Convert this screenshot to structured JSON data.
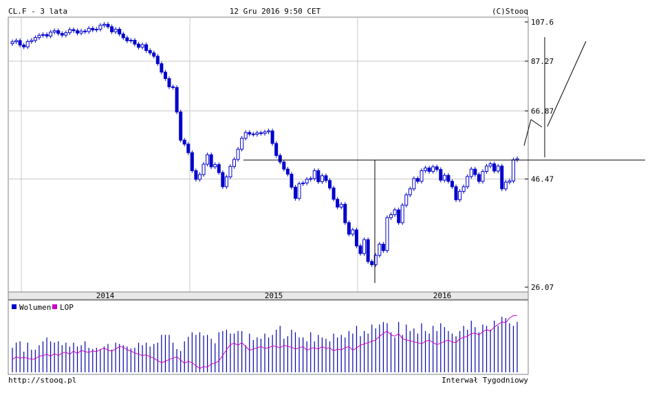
{
  "header": {
    "symbol_period": "CL.F - 3 lata",
    "datetime": "12 Gru 2016 9:50 CET",
    "copyright": "(C)Stooq"
  },
  "footer": {
    "url": "http://stooq.pl",
    "interval": "Interwał Tygodniowy"
  },
  "colors": {
    "bull_candle": "#ffffff",
    "bear_candle": "#0000cc",
    "candle_outline": "#0000cc",
    "volume_bar": "#0000aa",
    "lop_line": "#cc00cc",
    "grid": "#c8c8c8",
    "year_band": "#e8e8e8"
  },
  "chart_data": [
    {
      "type": "candlestick",
      "title": "CL.F - 3 lata",
      "ylim": [
        26.07,
        107.6
      ],
      "y_scale": "log",
      "y_ticks": [
        "107.6",
        "87.27",
        "66.87",
        "46.47",
        "26.07"
      ],
      "x_labels": [
        "2014",
        "2015",
        "2016"
      ],
      "grid": true,
      "weekly_close_from_2013_12": [
        96.8,
        97.4,
        95.1,
        94.2,
        96.9,
        97.5,
        99.0,
        100.2,
        100.6,
        99.8,
        101.9,
        102.7,
        101.2,
        100.3,
        101.6,
        103.3,
        102.7,
        101.4,
        102.5,
        102.2,
        104.0,
        103.1,
        103.5,
        105.7,
        106.3,
        104.9,
        102.1,
        103.5,
        100.9,
        98.9,
        97.3,
        97.6,
        95.6,
        94.0,
        95.3,
        92.4,
        91.2,
        89.6,
        86.1,
        82.3,
        79.5,
        76.1,
        75.8,
        66.5,
        57.2,
        56.0,
        53.5,
        48.6,
        46.4,
        47.6,
        50.3,
        52.9,
        49.6,
        50.2,
        48.1,
        44.6,
        47.0,
        49.7,
        51.6,
        54.5,
        57.8,
        59.6,
        59.1,
        59.0,
        59.5,
        59.3,
        59.8,
        60.1,
        56.2,
        52.7,
        50.9,
        49.0,
        47.7,
        44.5,
        41.9,
        45.3,
        45.5,
        46.4,
        46.6,
        48.6,
        45.8,
        47.3,
        46.1,
        44.3,
        41.7,
        40.0,
        40.6,
        36.8,
        34.6,
        35.4,
        32.5,
        31.2,
        33.6,
        29.9,
        29.4,
        30.9,
        32.8,
        31.7,
        37.8,
        38.4,
        39.4,
        36.8,
        40.4,
        42.7,
        44.1,
        46.6,
        45.9,
        48.6,
        49.3,
        48.4,
        49.6,
        48.9,
        46.2,
        47.4,
        45.9,
        44.6,
        41.6,
        43.5,
        44.6,
        47.1,
        49.0,
        47.6,
        45.9,
        48.4,
        49.8,
        50.4,
        48.5,
        49.8,
        44.1,
        45.7,
        46.0,
        51.5,
        51.8
      ],
      "weekly_volume_pct_of_max": [
        38,
        46,
        48,
        32,
        46,
        35,
        35,
        42,
        48,
        54,
        48,
        46,
        48,
        42,
        46,
        40,
        46,
        40,
        42,
        48,
        38,
        36,
        38,
        36,
        40,
        44,
        35,
        46,
        44,
        42,
        40,
        37,
        38,
        46,
        42,
        46,
        40,
        44,
        46,
        58,
        58,
        58,
        46,
        36,
        33,
        48,
        55,
        62,
        58,
        62,
        57,
        58,
        52,
        45,
        62,
        64,
        66,
        60,
        60,
        64,
        64,
        42,
        60,
        50,
        54,
        52,
        60,
        54,
        58,
        66,
        72,
        52,
        56,
        66,
        62,
        54,
        54,
        48,
        62,
        48,
        58,
        54,
        52,
        48,
        60,
        54,
        58,
        54,
        64,
        60,
        72,
        56,
        64,
        60,
        74,
        68,
        74,
        78,
        76,
        62,
        54,
        78,
        58,
        74,
        64,
        68,
        60,
        76,
        64,
        60,
        72,
        64,
        76,
        70,
        64,
        60,
        56,
        64,
        72,
        66,
        80,
        70,
        62,
        74,
        72,
        66,
        80,
        72,
        86,
        84,
        76,
        72,
        78
      ],
      "weekly_lop_pct": [
        20,
        24,
        22,
        23,
        22,
        20,
        21,
        25,
        26,
        28,
        25,
        29,
        26,
        30,
        31,
        28,
        33,
        29,
        34,
        32,
        31,
        33,
        32,
        35,
        38,
        34,
        33,
        36,
        40,
        39,
        35,
        33,
        30,
        28,
        26,
        27,
        24,
        22,
        18,
        15,
        17,
        20,
        22,
        24,
        19,
        14,
        17,
        15,
        10,
        6,
        9,
        8,
        13,
        14,
        18,
        26,
        35,
        43,
        45,
        42,
        46,
        40,
        34,
        36,
        38,
        40,
        37,
        38,
        41,
        40,
        38,
        42,
        40,
        39,
        36,
        38,
        40,
        34,
        37,
        38,
        36,
        40,
        37,
        38,
        33,
        36,
        35,
        38,
        40,
        34,
        38,
        42,
        44,
        46,
        48,
        50,
        56,
        60,
        64,
        58,
        56,
        60,
        52,
        50,
        49,
        47,
        46,
        44,
        48,
        50,
        46,
        43,
        45,
        48,
        50,
        47,
        46,
        52,
        54,
        56,
        60,
        61,
        58,
        63,
        66,
        64,
        70,
        74,
        78,
        77,
        84,
        88,
        88
      ]
    },
    {
      "type": "bar",
      "legend": [
        "Wolumen",
        "LOP"
      ]
    }
  ]
}
